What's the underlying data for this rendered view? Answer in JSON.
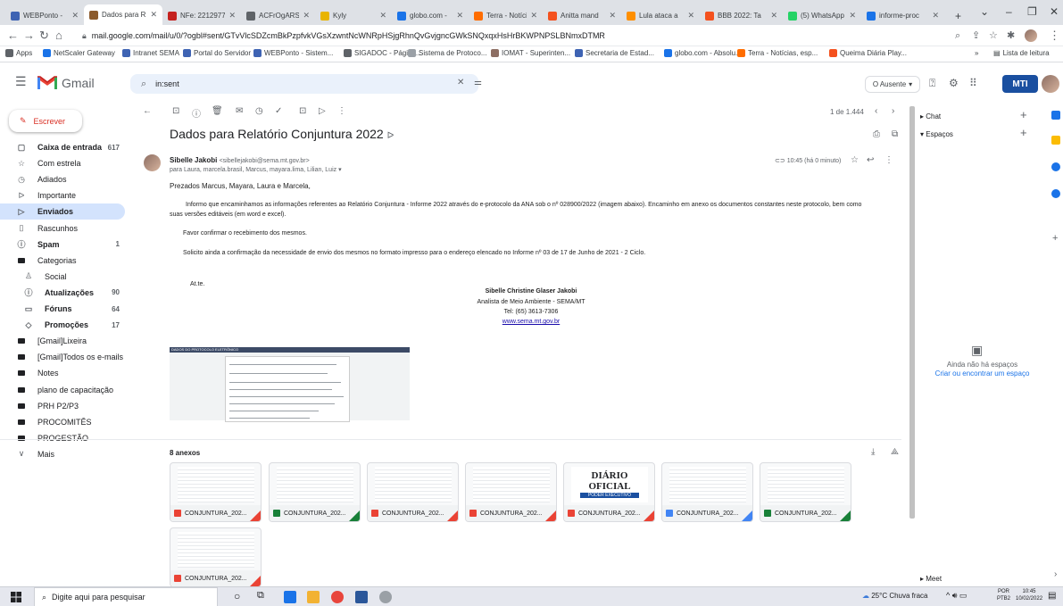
{
  "browser": {
    "tabs": [
      {
        "title": "WEBPonto - ",
        "color": "#3e63b3",
        "active": false
      },
      {
        "title": "Dados para R",
        "color": "#8b5a2b",
        "active": true
      },
      {
        "title": "NFe: 2212977",
        "color": "#c5221f",
        "active": false
      },
      {
        "title": "ACFrOgARSG",
        "color": "#5f6368",
        "active": false
      },
      {
        "title": "Kyly",
        "color": "#e8b400",
        "active": false
      },
      {
        "title": "globo.com -",
        "color": "#1a73e8",
        "active": false
      },
      {
        "title": "Terra - Notíci",
        "color": "#ff6d00",
        "active": false
      },
      {
        "title": "Anitta mand",
        "color": "#f4511e",
        "active": false
      },
      {
        "title": "Lula ataca a",
        "color": "#ff8f00",
        "active": false
      },
      {
        "title": "BBB 2022: Ta",
        "color": "#f4511e",
        "active": false
      },
      {
        "title": "(5) WhatsApp",
        "color": "#25d366",
        "active": false
      },
      {
        "title": "informe-proc",
        "color": "#1a73e8",
        "active": false
      }
    ],
    "new_tab": "+",
    "url": "mail.google.com/mail/u/0/?ogbl#sent/GTvVlcSDZcmBkPzpfvkVGsXzwntNcWNRpHSjgRhnQvGvjgncGWkSNQxqxHsHrBKWPNPSLBNmxDTMR",
    "bookmarks": [
      {
        "label": "Apps",
        "color": "#5f6368"
      },
      {
        "label": "NetScaler Gateway",
        "color": "#1a73e8"
      },
      {
        "label": "Intranet SEMA",
        "color": "#3e63b3"
      },
      {
        "label": "Portal do Servidor",
        "color": "#3e63b3"
      },
      {
        "label": "WEBPonto - Sistem...",
        "color": "#3e63b3"
      },
      {
        "label": "SIGADOC - Página...",
        "color": "#5f6368"
      },
      {
        "label": "Sistema de Protoco...",
        "color": "#9aa0a6"
      },
      {
        "label": "IOMAT - Superinten...",
        "color": "#8d6e63"
      },
      {
        "label": "Secretaria de Estad...",
        "color": "#3e63b3"
      },
      {
        "label": "globo.com - Absolu...",
        "color": "#1a73e8"
      },
      {
        "label": "Terra - Notícias, esp...",
        "color": "#ff6d00"
      },
      {
        "label": "Queima Diária Play...",
        "color": "#f4511e"
      }
    ],
    "bookmarks_more": "»",
    "reading_list": "Lista de leitura"
  },
  "gmail": {
    "logo_text": "Gmail",
    "search_value": "in:sent",
    "status": "O Ausente",
    "compose": "Escrever",
    "sidebar": [
      {
        "icon": "inbox-icon",
        "glyph": "▢",
        "label": "Caixa de entrada",
        "count": "617",
        "bold": true
      },
      {
        "icon": "star-icon",
        "glyph": "☆",
        "label": "Com estrela",
        "count": "",
        "bold": false
      },
      {
        "icon": "clock-icon",
        "glyph": "◷",
        "label": "Adiados",
        "count": "",
        "bold": false
      },
      {
        "icon": "important-icon",
        "glyph": "ᐅ",
        "label": "Importante",
        "count": "",
        "bold": false
      },
      {
        "icon": "send-icon",
        "glyph": "▷",
        "label": "Enviados",
        "count": "",
        "bold": true,
        "active": true
      },
      {
        "icon": "draft-icon",
        "glyph": "▯",
        "label": "Rascunhos",
        "count": "",
        "bold": false
      },
      {
        "icon": "spam-icon",
        "glyph": "ⓘ",
        "label": "Spam",
        "count": "1",
        "bold": true
      },
      {
        "icon": "label-icon",
        "glyph": "■",
        "label": "Categorias",
        "count": "",
        "bold": false
      },
      {
        "icon": "social-icon",
        "glyph": "♙",
        "label": "Social",
        "count": "",
        "bold": false,
        "sub": true
      },
      {
        "icon": "info-icon",
        "glyph": "ⓘ",
        "label": "Atualizações",
        "count": "90",
        "bold": true,
        "sub": true
      },
      {
        "icon": "forum-icon",
        "glyph": "▭",
        "label": "Fóruns",
        "count": "64",
        "bold": true,
        "sub": true
      },
      {
        "icon": "tag-icon",
        "glyph": "◇",
        "label": "Promoções",
        "count": "17",
        "bold": true,
        "sub": true
      },
      {
        "icon": "label-icon",
        "glyph": "■",
        "label": "[Gmail]Lixeira",
        "count": "",
        "bold": false
      },
      {
        "icon": "label-icon",
        "glyph": "■",
        "label": "[Gmail]Todos os e-mails",
        "count": "",
        "bold": false
      },
      {
        "icon": "label-icon",
        "glyph": "■",
        "label": "Notes",
        "count": "",
        "bold": false
      },
      {
        "icon": "label-icon",
        "glyph": "■",
        "label": "plano de capacitação",
        "count": "",
        "bold": false
      },
      {
        "icon": "label-icon",
        "glyph": "■",
        "label": "PRH P2/P3",
        "count": "",
        "bold": false
      },
      {
        "icon": "label-icon",
        "glyph": "■",
        "label": "PROCOMITÊS",
        "count": "",
        "bold": false
      },
      {
        "icon": "label-icon",
        "glyph": "■",
        "label": "PROGESTÃO",
        "count": "",
        "bold": false
      },
      {
        "icon": "chevron-down-icon",
        "glyph": "∨",
        "label": "Mais",
        "count": "",
        "bold": false
      }
    ],
    "pagination": "1 de 1.444",
    "message": {
      "subject": "Dados para Relatório Conjuntura 2022",
      "sender_name": "Sibelle Jakobi",
      "sender_email": "<sibellejakobi@sema.mt.gov.br>",
      "recipients": "para Laura, marcela.brasil, Marcus, mayara.lima, Lilian, Luiz",
      "time": "10:45 (há 0 minuto)",
      "greeting": "Prezados Marcus, Mayara, Laura e Marcela,",
      "p1_line1": "Informo que encaminhamos as informações referentes ao Relatório Conjuntura - Informe 2022 através do e-protocolo da ANA sob o nº 028900/2022 (imagem abaixo). Encaminho em anexo os documentos constantes neste protocolo, bem como",
      "p1_line2": "suas versões editáveis (em word e excel).",
      "p2": "Favor confirmar o recebimento dos mesmos.",
      "p3": "Solicito ainda a confirmação da necessidade de envio dos mesmos no formato impresso para o endereço elencado no Informe nº 03 de 17 de Junho de 2021 - 2 Ciclo.",
      "closing": "At.te.",
      "sig_name": "Sibelle Christine Glaser Jakobi",
      "sig_role": "Analista de Meio Ambiente - SEMA/MT",
      "sig_phone": "Tel: (65) 3613-7306",
      "sig_site": "www.sema.mt.gov.br",
      "image_caption": "DADOS DO PROTOCOLO ELETRÔNICO"
    },
    "attachments_title": "8 anexos",
    "attachments": [
      {
        "name": "CONJUNTURA_202...",
        "type": "pdf",
        "color": "#ea4335",
        "corner": "#ea4335"
      },
      {
        "name": "CONJUNTURA_202...",
        "type": "xls",
        "color": "#188038",
        "corner": "#188038"
      },
      {
        "name": "CONJUNTURA_202...",
        "type": "pdf",
        "color": "#ea4335",
        "corner": "#ea4335"
      },
      {
        "name": "CONJUNTURA_202...",
        "type": "pdf",
        "color": "#ea4335",
        "corner": "#ea4335"
      },
      {
        "name": "CONJUNTURA_202...",
        "type": "pdf",
        "color": "#ea4335",
        "corner": "#ea4335",
        "diario": "DIÁRIO OFICIAL",
        "poder": "PODER EXECUTIVO"
      },
      {
        "name": "CONJUNTURA_202...",
        "type": "doc",
        "color": "#4285f4",
        "corner": "#4285f4"
      },
      {
        "name": "CONJUNTURA_202...",
        "type": "xls",
        "color": "#188038",
        "corner": "#188038"
      },
      {
        "name": "CONJUNTURA_202...",
        "type": "pdf",
        "color": "#ea4335",
        "corner": "#ea4335"
      }
    ],
    "right_panel": {
      "chat": "Chat",
      "spaces": "Espaços",
      "empty": "Ainda não há espaços",
      "create": "Criar ou encontrar um espaço",
      "meet": "Meet"
    },
    "badge": "MTI"
  },
  "taskbar": {
    "search": "Digite aqui para pesquisar",
    "weather": "25°C  Chuva fraca",
    "lang1": "POR",
    "lang2": "PTB2",
    "time": "10:45",
    "date": "10/02/2022"
  }
}
